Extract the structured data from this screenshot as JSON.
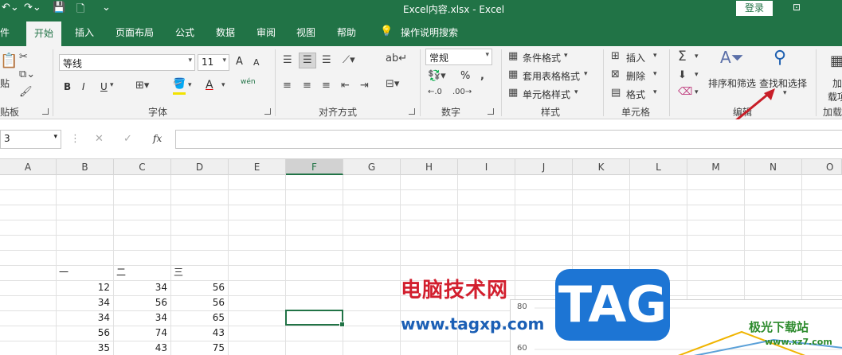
{
  "titlebar": {
    "title": "Excel内容.xlsx  -  Excel",
    "login": "登录"
  },
  "tabs": [
    {
      "label": "件"
    },
    {
      "label": "开始"
    },
    {
      "label": "插入"
    },
    {
      "label": "页面布局"
    },
    {
      "label": "公式"
    },
    {
      "label": "数据"
    },
    {
      "label": "审阅"
    },
    {
      "label": "视图"
    },
    {
      "label": "帮助"
    },
    {
      "label": "操作说明搜索"
    }
  ],
  "ribbon": {
    "clipboard": {
      "paste": "贴",
      "label": "贴板"
    },
    "font": {
      "name": "等线",
      "size": "11",
      "bold": "B",
      "italic": "I",
      "underline": "U",
      "grow": "A",
      "shrink": "A",
      "phonetic": "wén",
      "label": "字体"
    },
    "alignment": {
      "label": "对齐方式"
    },
    "number": {
      "format": "常规",
      "percent": "%",
      "label": "数字"
    },
    "styles": {
      "cond": "条件格式",
      "table": "套用表格格式",
      "cell": "单元格样式",
      "label": "样式"
    },
    "cells": {
      "insert": "插入",
      "delete": "删除",
      "format": "格式",
      "label": "单元格"
    },
    "editing": {
      "sort": "排序和筛选",
      "find": "查找和选择",
      "label": "编辑"
    },
    "addins": {
      "top": "加",
      "bottom": "载项",
      "label": "加载"
    }
  },
  "formula_bar": {
    "namebox": "3",
    "fx": "fx"
  },
  "columns": [
    "A",
    "B",
    "C",
    "D",
    "E",
    "F",
    "G",
    "H",
    "I",
    "J",
    "K",
    "L",
    "M",
    "N",
    "O"
  ],
  "selected_column": "F",
  "sheet": {
    "headers": [
      "一",
      "二",
      "三"
    ],
    "rows": [
      [
        "12",
        "34",
        "56"
      ],
      [
        "34",
        "56",
        "56"
      ],
      [
        "34",
        "34",
        "65"
      ],
      [
        "56",
        "74",
        "43"
      ],
      [
        "35",
        "43",
        "75"
      ]
    ]
  },
  "chart_ticks": [
    "80",
    "60"
  ],
  "watermark": {
    "text": "电脑技术网",
    "url": "www.tagxp.com",
    "badge": "TAG",
    "site": "极光下载站",
    "site_url": "www.xz7.com"
  },
  "colors": {
    "accent": "#217346",
    "arrow": "#c81e28"
  }
}
